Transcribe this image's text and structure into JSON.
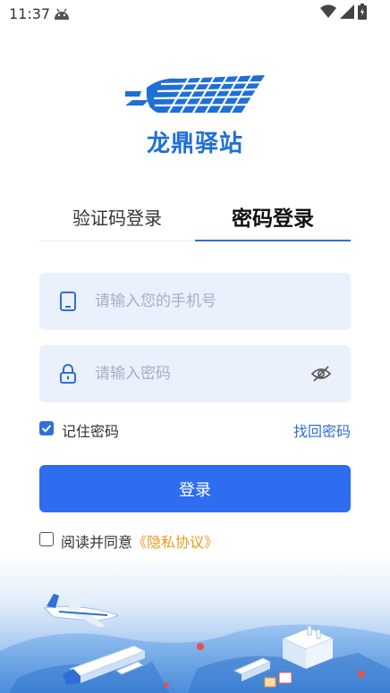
{
  "status_bar": {
    "time": "11:37"
  },
  "brand": {
    "name": "龙鼎驿站",
    "color": "#1f6fd6"
  },
  "tabs": [
    {
      "label": "验证码登录",
      "active": false
    },
    {
      "label": "密码登录",
      "active": true
    }
  ],
  "form": {
    "phone_placeholder": "请输入您的手机号",
    "password_placeholder": "请输入密码",
    "remember_label": "记住密码",
    "remember_checked": true,
    "forgot_label": "找回密码",
    "login_label": "登录"
  },
  "agreement": {
    "text": "阅读并同意",
    "link": "《隐私协议》",
    "checked": false
  },
  "colors": {
    "accent": "#2f6df0",
    "link": "#2f6fd8",
    "privacy": "#e89a1e",
    "field_bg": "#eaf0fc"
  }
}
